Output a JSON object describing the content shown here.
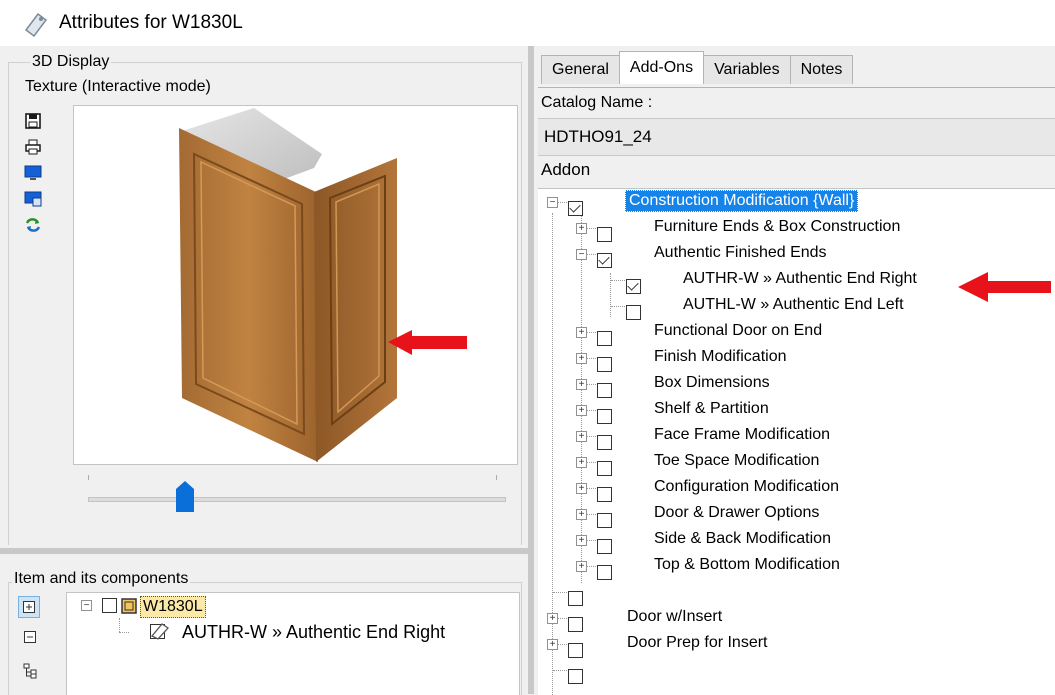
{
  "window": {
    "title": "Attributes for W1830L",
    "icon": "tag-icon"
  },
  "display": {
    "group_title": "3D Display",
    "mode_label": "Texture (Interactive mode)",
    "toolbar": [
      {
        "name": "save-icon"
      },
      {
        "name": "print-icon"
      },
      {
        "name": "monitor-icon"
      },
      {
        "name": "monitor-view-icon"
      },
      {
        "name": "refresh-icon"
      }
    ],
    "slider": {
      "value_fraction": 0.22
    },
    "cabinet_colors": {
      "wood": "#b87a3a",
      "wood_dark": "#8a5524",
      "top": "#d4d4d4"
    },
    "arrow_color": "#e8121b"
  },
  "components": {
    "group_title": "Item and its components",
    "root_label": "W1830L",
    "child_label": "AUTHR-W » Authentic End Right",
    "toolbar": [
      {
        "name": "expand-all-icon"
      },
      {
        "name": "collapse-all-icon"
      },
      {
        "name": "tree-icon"
      }
    ]
  },
  "tabs": [
    {
      "label": "General",
      "active": false
    },
    {
      "label": "Add-Ons",
      "active": true
    },
    {
      "label": "Variables",
      "active": false
    },
    {
      "label": "Notes",
      "active": false
    }
  ],
  "catalog": {
    "label": "Catalog Name :",
    "value": "HDTHO91_24"
  },
  "addon": {
    "label": "Addon",
    "items": [
      {
        "text": "Construction Modification {Wall}",
        "level": 0,
        "exp": "−",
        "checked": true,
        "selected": true
      },
      {
        "text": "Furniture Ends & Box Construction",
        "level": 1,
        "exp": "+",
        "checked": false
      },
      {
        "text": "Authentic Finished Ends",
        "level": 1,
        "exp": "−",
        "checked": true
      },
      {
        "text": "AUTHR-W » Authentic End Right",
        "level": 2,
        "exp": "",
        "checked": true
      },
      {
        "text": "AUTHL-W » Authentic End Left",
        "level": 2,
        "exp": "",
        "checked": false
      },
      {
        "text": "Functional Door on End",
        "level": 1,
        "exp": "+",
        "checked": false
      },
      {
        "text": "Finish Modification",
        "level": 1,
        "exp": "+",
        "checked": false
      },
      {
        "text": "Box Dimensions",
        "level": 1,
        "exp": "+",
        "checked": false
      },
      {
        "text": "Shelf & Partition",
        "level": 1,
        "exp": "+",
        "checked": false
      },
      {
        "text": "Face Frame Modification",
        "level": 1,
        "exp": "+",
        "checked": false
      },
      {
        "text": "Toe Space Modification",
        "level": 1,
        "exp": "+",
        "checked": false
      },
      {
        "text": "Configuration Modification",
        "level": 1,
        "exp": "+",
        "checked": false
      },
      {
        "text": "Door & Drawer Options",
        "level": 1,
        "exp": "+",
        "checked": false
      },
      {
        "text": "Side & Back Modification",
        "level": 1,
        "exp": "+",
        "checked": false
      },
      {
        "text": "Top & Bottom Modification",
        "level": 1,
        "exp": "+",
        "checked": false
      },
      {
        "text": "",
        "level": 0,
        "exp": "",
        "checked": false
      },
      {
        "text": "Door w/Insert",
        "level": 0,
        "exp": "+",
        "checked": false
      },
      {
        "text": "Door Prep for Insert",
        "level": 0,
        "exp": "+",
        "checked": false
      },
      {
        "text": "",
        "level": 0,
        "exp": "",
        "checked": false
      }
    ]
  }
}
